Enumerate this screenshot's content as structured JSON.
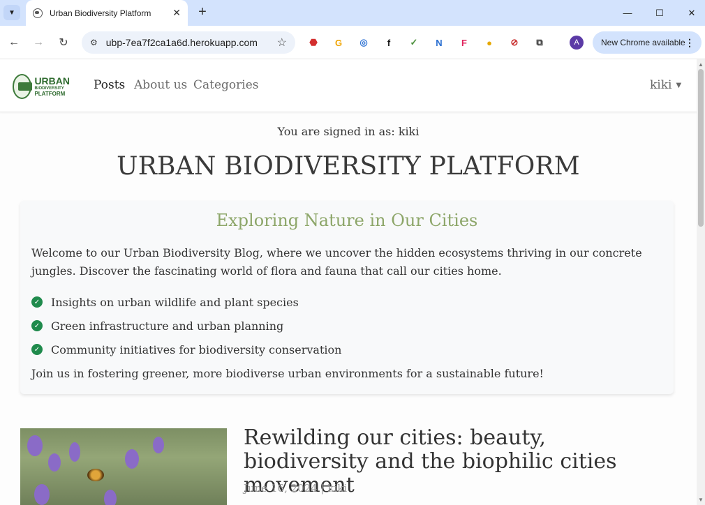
{
  "browser": {
    "tab_title": "Urban Biodiversity Platform",
    "url": "ubp-7ea7f2ca1a6d.herokuapp.com",
    "update_label": "New Chrome available",
    "profile_initial": "A"
  },
  "nav": {
    "logo_line1": "URBAN",
    "logo_line2": "BIODIVERSITY",
    "logo_line3": "PLATFORM",
    "links": [
      "Posts",
      "About us",
      "Categories"
    ],
    "user": "kiki"
  },
  "page": {
    "signed_in": "You are signed in as: kiki",
    "headline": "URBAN BIODIVERSITY PLATFORM"
  },
  "hero": {
    "subtitle": "Exploring Nature in Our Cities",
    "intro": "Welcome to our Urban Biodiversity Blog, where we uncover the hidden ecosystems thriving in our concrete jungles. Discover the fascinating world of flora and fauna that call our cities home.",
    "features": [
      "Insights on urban wildlife and plant species",
      "Green infrastructure and urban planning",
      "Community initiatives for biodiversity conservation"
    ],
    "outro": "Join us in fostering greener, more biodiverse urban environments for a sustainable future!"
  },
  "posts": [
    {
      "title": "Rewilding our cities: beauty, biodiversity and the biophilic cities movement",
      "date": "June 16, 2024",
      "author": "kiki"
    }
  ],
  "colors": {
    "accent_green": "#8da669",
    "check_green": "#1f8a4c"
  }
}
